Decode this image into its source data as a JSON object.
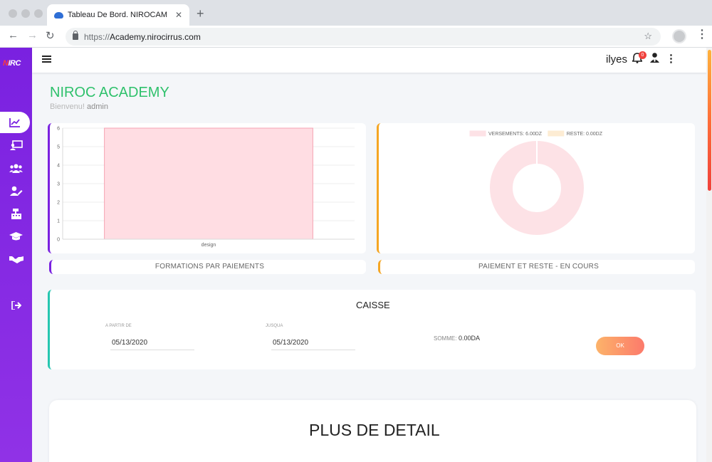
{
  "browser": {
    "tab_title": "Tableau De Bord. NIROCAM",
    "url_protocol": "https://",
    "url_host": "Academy.nirocirrus.com"
  },
  "sidebar": {
    "logo_text": "NIRC",
    "items": [
      {
        "icon": "chart-line-icon"
      },
      {
        "icon": "chalkboard-teacher-icon"
      },
      {
        "icon": "users-icon"
      },
      {
        "icon": "user-edit-icon"
      },
      {
        "icon": "cash-register-icon"
      },
      {
        "icon": "graduation-cap-icon"
      },
      {
        "icon": "handshake-icon"
      },
      {
        "icon": "sign-out-icon"
      }
    ]
  },
  "topbar": {
    "username": "ilyes",
    "notification_count": "0"
  },
  "header": {
    "title": "NIROC ACADEMY",
    "welcome": "Bienvenu!",
    "role": "admin"
  },
  "bar_chart_card": {
    "label": "FORMATIONS PAR PAIEMENTS"
  },
  "donut_chart_card": {
    "label": "PAIEMENT ET RESTE - EN COURS"
  },
  "chart_data": [
    {
      "type": "bar",
      "categories": [
        "design"
      ],
      "values": [
        6
      ],
      "ylim": [
        0,
        6
      ],
      "yticks": [
        "0",
        "1",
        "2",
        "3",
        "4",
        "5",
        "6"
      ],
      "grid": true,
      "bar_color": "#ffdde3"
    },
    {
      "type": "pie",
      "donut": true,
      "series": [
        {
          "name": "VERSEMENTS: 6.00DZ",
          "value": 6.0,
          "color": "#fde2e6"
        },
        {
          "name": "RESTE: 0.00DZ",
          "value": 0.0,
          "color": "#fdecd3"
        }
      ],
      "legend": "top"
    }
  ],
  "caisse": {
    "title": "CAISSE",
    "from_label": "A PARTIR DE",
    "from_value": "05/13/2020",
    "to_label": "JUSQUA",
    "to_value": "05/13/2020",
    "somme_label": "SOMME:",
    "somme_value": "0.00DA",
    "ok_label": "OK"
  },
  "detail": {
    "title": "PLUS DE DETAIL"
  },
  "colors": {
    "sidebar": "#7a21e0",
    "title_green": "#2fc16c",
    "accent_orange": "#f5a623",
    "accent_teal": "#26c6b0"
  }
}
